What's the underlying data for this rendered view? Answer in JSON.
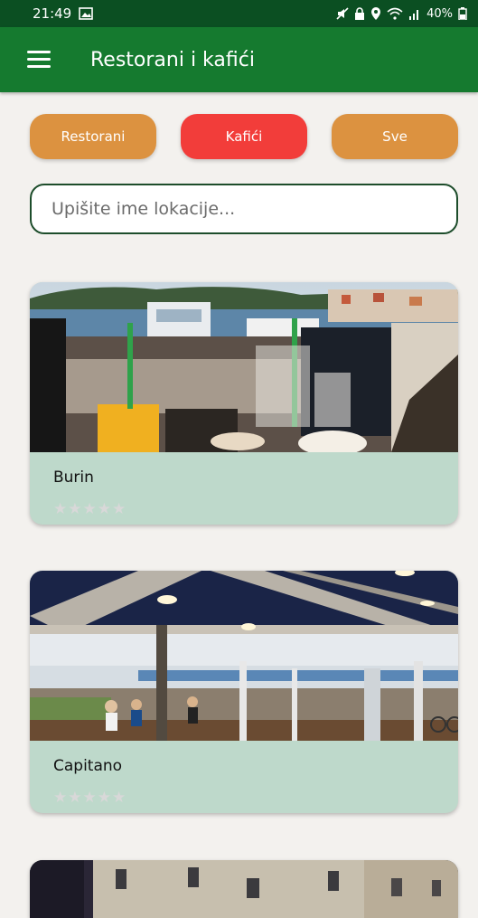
{
  "status": {
    "time": "21:49",
    "battery": "40%"
  },
  "app": {
    "title": "Restorani i kafići"
  },
  "filters": [
    {
      "label": "Restorani",
      "color": "#dc9240"
    },
    {
      "label": "Kafići",
      "color": "#f23d3a"
    },
    {
      "label": "Sve",
      "color": "#dc9240"
    }
  ],
  "search": {
    "placeholder": "Upišite ime lokacije...",
    "value": ""
  },
  "places": [
    {
      "name": "Burin",
      "stars": "★★★★★",
      "rating": 0
    },
    {
      "name": "Capitano",
      "stars": "★★★★★",
      "rating": 0
    }
  ],
  "colors": {
    "status_bar": "#0b4f22",
    "app_bar": "#157a2f",
    "card": "#bed9cb",
    "background": "#f3f1ee"
  }
}
